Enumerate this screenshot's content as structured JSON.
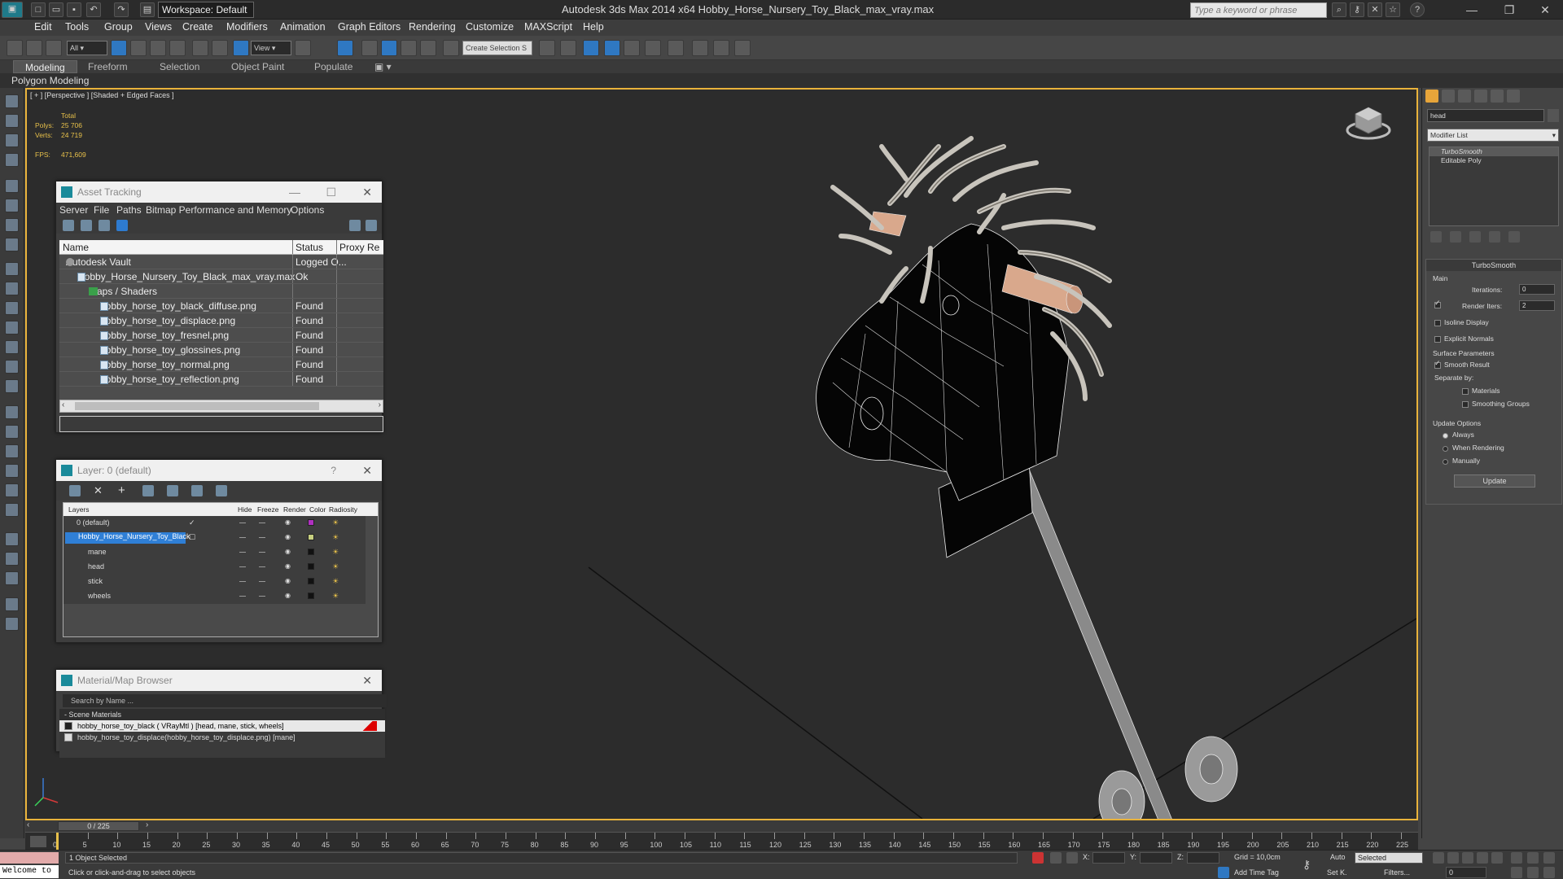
{
  "titlebar": {
    "workspace": "Workspace: Default",
    "title": "Autodesk 3ds Max  2014 x64      Hobby_Horse_Nursery_Toy_Black_max_vray.max",
    "search_placeholder": "Type a keyword or phrase"
  },
  "menu": [
    "Edit",
    "Tools",
    "Group",
    "Views",
    "Create",
    "Modifiers",
    "Animation",
    "Graph Editors",
    "Rendering",
    "Customize",
    "MAXScript",
    "Help"
  ],
  "toolbar": {
    "filter": "All",
    "view": "View",
    "selection_set": "Create Selection S"
  },
  "ribbon": {
    "tabs": [
      "Modeling",
      "Freeform",
      "Selection",
      "Object Paint",
      "Populate"
    ],
    "subtab": "Polygon Modeling"
  },
  "viewport": {
    "label": "[ + ] [Perspective ] [Shaded + Edged Faces ]",
    "stats_total": "Total",
    "polys_label": "Polys:",
    "polys_value": "25 706",
    "verts_label": "Verts:",
    "verts_value": "24 719",
    "fps_label": "FPS:",
    "fps_value": "471,609"
  },
  "asset_tracking": {
    "title": "Asset Tracking",
    "menu": [
      "Server",
      "File",
      "Paths",
      "Bitmap Performance and Memory",
      "Options"
    ],
    "columns": [
      "Name",
      "Status",
      "Proxy Re"
    ],
    "rows": [
      {
        "name": "Autodesk Vault",
        "status": "Logged O...",
        "indent": 0,
        "icon": "vault"
      },
      {
        "name": "Hobby_Horse_Nursery_Toy_Black_max_vray.max",
        "status": "Ok",
        "indent": 1,
        "icon": "file"
      },
      {
        "name": "Maps / Shaders",
        "status": "",
        "indent": 2,
        "icon": "folder"
      },
      {
        "name": "hobby_horse_toy_black_diffuse.png",
        "status": "Found",
        "indent": 3,
        "icon": "file"
      },
      {
        "name": "hobby_horse_toy_displace.png",
        "status": "Found",
        "indent": 3,
        "icon": "file"
      },
      {
        "name": "hobby_horse_toy_fresnel.png",
        "status": "Found",
        "indent": 3,
        "icon": "file"
      },
      {
        "name": "hobby_horse_toy_glossines.png",
        "status": "Found",
        "indent": 3,
        "icon": "file"
      },
      {
        "name": "hobby_horse_toy_normal.png",
        "status": "Found",
        "indent": 3,
        "icon": "file"
      },
      {
        "name": "hobby_horse_toy_reflection.png",
        "status": "Found",
        "indent": 3,
        "icon": "file"
      }
    ]
  },
  "layer_panel": {
    "title": "Layer: 0 (default)",
    "help": "?",
    "columns": [
      "Layers",
      "Hide",
      "Freeze",
      "Render",
      "Color",
      "Radiosity"
    ],
    "rows": [
      {
        "name": "0 (default)",
        "color": "#b030c0",
        "selected": false,
        "check": true
      },
      {
        "name": "Hobby_Horse_Nursery_Toy_Black",
        "color": "#c8d080",
        "selected": true,
        "check": false
      },
      {
        "name": "mane",
        "color": "#111111",
        "selected": false,
        "check": false
      },
      {
        "name": "head",
        "color": "#111111",
        "selected": false,
        "check": false
      },
      {
        "name": "stick",
        "color": "#111111",
        "selected": false,
        "check": false
      },
      {
        "name": "wheels",
        "color": "#111111",
        "selected": false,
        "check": false
      }
    ]
  },
  "material_browser": {
    "title": "Material/Map Browser",
    "search": "Search by Name ...",
    "category": "- Scene Materials",
    "items": [
      "hobby_horse_toy_black  ( VRayMtl )  [head, mane, stick, wheels]",
      "hobby_horse_toy_displace(hobby_horse_toy_displace.png) [mane]"
    ]
  },
  "command_panel": {
    "object_name": "head",
    "modifier_list": "Modifier List",
    "stack": [
      "TurboSmooth",
      "Editable Poly"
    ],
    "turbosmooth": {
      "title": "TurboSmooth",
      "main": "Main",
      "iterations_label": "Iterations:",
      "iterations": "0",
      "render_iters_label": "Render Iters:",
      "render_iters": "2",
      "isoline": "Isoline Display",
      "explicit_normals": "Explicit Normals",
      "surface_params": "Surface Parameters",
      "smooth_result": "Smooth Result",
      "separate_by": "Separate by:",
      "materials": "Materials",
      "smoothing_groups": "Smoothing Groups",
      "update_options": "Update Options",
      "always": "Always",
      "when_rendering": "When Rendering",
      "manually": "Manually",
      "update_button": "Update"
    }
  },
  "timeline": {
    "frame": "0 / 225",
    "ticks": [
      "0",
      "5",
      "10",
      "15",
      "20",
      "25",
      "30",
      "35",
      "40",
      "45",
      "50",
      "55",
      "60",
      "65",
      "70",
      "75",
      "80",
      "85",
      "90",
      "95",
      "100",
      "105",
      "110",
      "115",
      "120",
      "125",
      "130",
      "135",
      "140",
      "145",
      "150",
      "155",
      "160",
      "165",
      "170",
      "175",
      "180",
      "185",
      "190",
      "195",
      "200",
      "205",
      "210",
      "215",
      "220",
      "225"
    ]
  },
  "status": {
    "maxscript": "Welcome to",
    "selected": "1 Object Selected",
    "hint": "Click or click-and-drag to select objects",
    "x_label": "X:",
    "y_label": "Y:",
    "z_label": "Z:",
    "grid": "Grid = 10,0cm",
    "add_time_tag": "Add Time Tag",
    "auto": "Auto",
    "selected_dropdown": "Selected",
    "set_k": "Set K.",
    "filters": "Filters...",
    "frame_field": "0"
  }
}
